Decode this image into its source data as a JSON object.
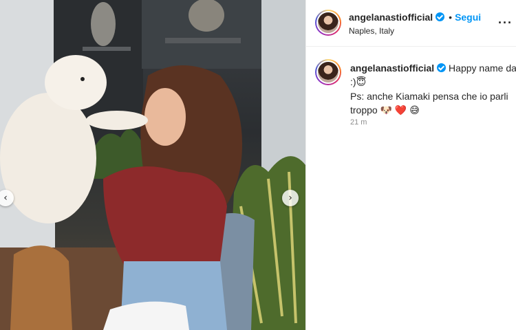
{
  "post": {
    "username": "angelanastiofficial",
    "follow_label": "Segui",
    "separator": "•",
    "location": "Naples, Italy",
    "more_icon": "more-options-icon",
    "verified_icon": "verified-badge-icon"
  },
  "caption": {
    "username": "angelanastiofficial",
    "line1": "Happy name day",
    "line2": ":)",
    "line2_emoji": "😇",
    "line3": "Ps: anche Kiamaki pensa che io parli",
    "line4": "troppo",
    "line4_emojis": [
      "🐶",
      "❤️",
      "😅"
    ],
    "timestamp": "21 m"
  },
  "carousel": {
    "prev_glyph": "‹",
    "next_glyph": "›"
  },
  "colors": {
    "accent": "#0095f6",
    "text": "#262626",
    "muted": "#8e8e8e"
  }
}
